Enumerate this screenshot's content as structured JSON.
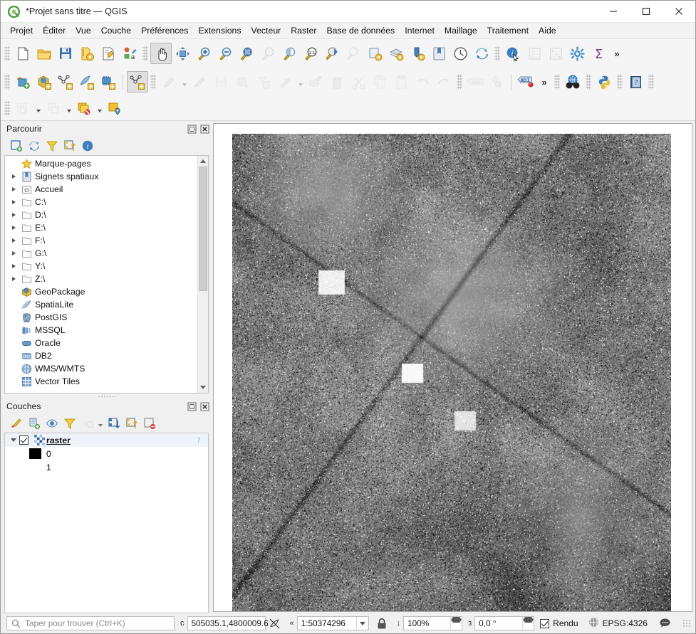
{
  "window": {
    "title": "*Projet sans titre — QGIS",
    "logo_icon": "qgis-logo-icon",
    "minimize_label": "—",
    "maximize_label": "☐",
    "close_label": "✕"
  },
  "menubar": {
    "items": [
      {
        "label": "Projet",
        "mnemonic": "P"
      },
      {
        "label": "Éditer",
        "mnemonic": "É"
      },
      {
        "label": "Vue",
        "mnemonic": "u"
      },
      {
        "label": "Couche",
        "mnemonic": "C"
      },
      {
        "label": "Préférences",
        "mnemonic": "P"
      },
      {
        "label": "Extensions",
        "mnemonic": "x"
      },
      {
        "label": "Vecteur",
        "mnemonic": "V"
      },
      {
        "label": "Raster",
        "mnemonic": "R"
      },
      {
        "label": "Base de données",
        "mnemonic": "B"
      },
      {
        "label": "Internet",
        "mnemonic": "I"
      },
      {
        "label": "Maillage",
        "mnemonic": "M"
      },
      {
        "label": "Traitement",
        "mnemonic": "T"
      },
      {
        "label": "Aide",
        "mnemonic": "A"
      }
    ]
  },
  "toolbars": {
    "row1": [
      "new-project-icon",
      "open-project-icon",
      "save-project-icon",
      "save-project-as-icon",
      "project-properties-icon",
      "style-manager-icon",
      "pan-map-icon",
      "pan-to-selection-icon",
      "zoom-in-icon",
      "zoom-out-icon",
      "zoom-full-icon",
      "zoom-to-selection-icon",
      "zoom-to-layer-icon",
      "zoom-native-icon",
      "zoom-last-icon",
      "zoom-next-icon",
      "refresh-layer-icon",
      "show-all-layers-icon",
      "hide-all-layers-icon",
      "new-bookmark-icon",
      "temporal-controller-icon",
      "refresh-icon",
      "identify-features-icon",
      "open-attribute-table-icon",
      "field-calculator-icon",
      "options-icon",
      "statistics-icon"
    ],
    "row1_overflow_label": "»",
    "row2": [
      "current-edits-icon",
      "new-geopackage-icon",
      "new-shapefile-icon",
      "new-spatialite-icon",
      "new-memory-layer-icon",
      "toggle-editing-icon",
      "add-feature-icon",
      "edit-vertices-icon",
      "save-layer-edits-icon",
      "save-edits-icon",
      "add-point-icon",
      "modify-attributes-icon",
      "multi-edit-icon",
      "delete-selected-icon",
      "cut-features-icon",
      "copy-features-icon",
      "paste-features-icon",
      "undo-icon",
      "redo-icon",
      "label-icon",
      "3d-map-icon",
      "annotation-icon"
    ],
    "row2_overflow_label": "»",
    "row2_right": [
      "metasearch-icon",
      "python-console-icon",
      "help-icon"
    ],
    "row3": [
      "select-features-icon",
      "select-dropdown-caret",
      "deselect-icon",
      "deselect-dropdown-caret",
      "measure-icon",
      "measure-dropdown-caret",
      "new-map-view-icon"
    ]
  },
  "browser_panel": {
    "title": "Parcourir",
    "float_icon": "undock-icon",
    "close_icon": "close-icon",
    "toolbar": [
      "add-layer-icon",
      "refresh-icon",
      "filter-browser-icon",
      "collapse-all-icon",
      "properties-icon"
    ],
    "items": [
      {
        "label": "Marque-pages",
        "icon": "bookmark-star-icon",
        "expandable": false
      },
      {
        "label": "Signets spatiaux",
        "icon": "spatial-bookmarks-icon",
        "expandable": true
      },
      {
        "label": "Accueil",
        "icon": "home-folder-icon",
        "expandable": true
      },
      {
        "label": "C:\\",
        "icon": "folder-icon",
        "expandable": true
      },
      {
        "label": "D:\\",
        "icon": "folder-icon",
        "expandable": true
      },
      {
        "label": "E:\\",
        "icon": "folder-icon",
        "expandable": true
      },
      {
        "label": "F:\\",
        "icon": "folder-icon",
        "expandable": true
      },
      {
        "label": "G:\\",
        "icon": "folder-icon",
        "expandable": true
      },
      {
        "label": "Y:\\",
        "icon": "folder-icon",
        "expandable": true
      },
      {
        "label": "Z:\\",
        "icon": "folder-icon",
        "expandable": true
      },
      {
        "label": "GeoPackage",
        "icon": "geopackage-icon",
        "expandable": false
      },
      {
        "label": "SpatiaLite",
        "icon": "spatialite-icon",
        "expandable": false
      },
      {
        "label": "PostGIS",
        "icon": "postgis-icon",
        "expandable": false
      },
      {
        "label": "MSSQL",
        "icon": "mssql-icon",
        "expandable": false
      },
      {
        "label": "Oracle",
        "icon": "oracle-icon",
        "expandable": false
      },
      {
        "label": "DB2",
        "icon": "db2-icon",
        "expandable": false
      },
      {
        "label": "WMS/WMTS",
        "icon": "wms-icon",
        "expandable": false
      },
      {
        "label": "Vector Tiles",
        "icon": "vector-tiles-icon",
        "expandable": false
      }
    ]
  },
  "layers_panel": {
    "title": "Couches",
    "float_icon": "undock-icon",
    "close_icon": "close-icon",
    "toolbar": [
      "open-layer-styling-icon",
      "add-group-icon",
      "manage-visibility-icon",
      "filter-legend-icon",
      "expression-filter-icon",
      "expression-caret",
      "expand-all-icon",
      "collapse-all-icon",
      "remove-layer-icon"
    ],
    "layer": {
      "name": "raster",
      "checked": true,
      "icon": "raster-layer-icon",
      "help_icon": "help-question-icon",
      "symbology": [
        {
          "label": "0",
          "color": "#000000"
        },
        {
          "label": "1",
          "color": "#ffffff"
        }
      ]
    }
  },
  "map": {
    "layer_name": "raster",
    "description": "grayscale-raster-canvas"
  },
  "statusbar": {
    "search_placeholder": "Taper pour trouver (Ctrl+K)",
    "search_icon": "search-icon",
    "coordinate_label": "c",
    "coordinate_value": "505035.1,4800009.6",
    "coordinate_toggle_icon": "toggle-extents-icon",
    "scale_label": "«",
    "scale_value": "1:50374296",
    "lock_icon": "lock-scale-icon",
    "magnifier_label": "↓",
    "magnifier_value": "100%",
    "rotation_label": "з",
    "rotation_value": "0,0 °",
    "render_label": "Rendu",
    "render_checked": true,
    "crs_icon": "globe-icon",
    "crs_label": "EPSG:4326",
    "messages_icon": "messages-bubble-icon"
  }
}
